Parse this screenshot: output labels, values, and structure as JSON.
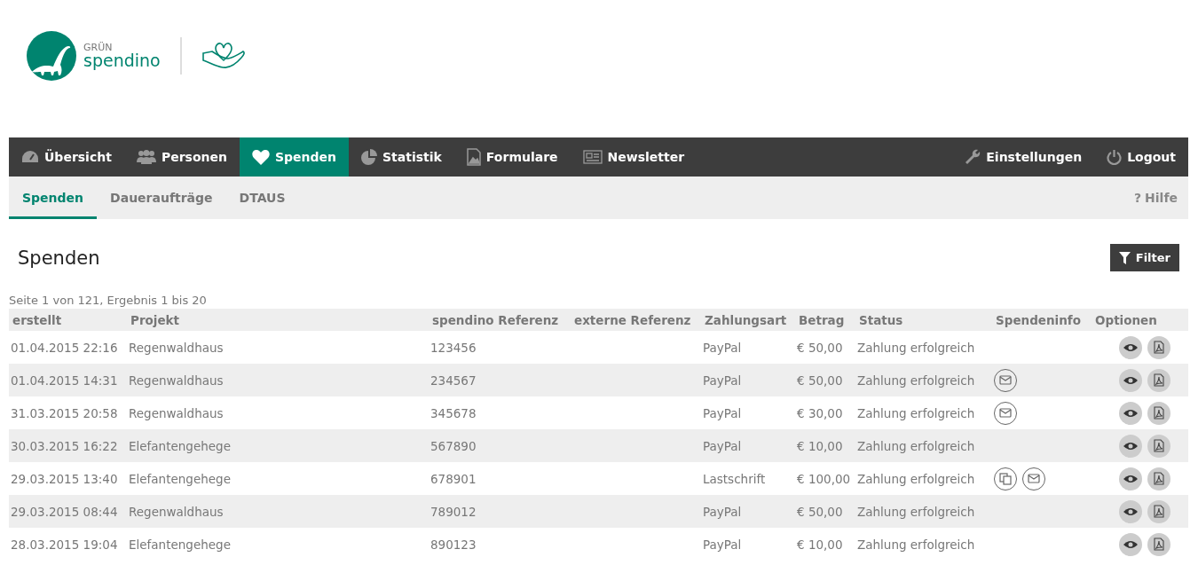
{
  "logo": {
    "line1": "GRÜN",
    "line2": "spendino"
  },
  "nav": [
    {
      "label": "Übersicht",
      "kind": "gauge",
      "selected": false
    },
    {
      "label": "Personen",
      "kind": "people",
      "selected": false
    },
    {
      "label": "Spenden",
      "kind": "heart",
      "selected": true
    },
    {
      "label": "Statistik",
      "kind": "pie",
      "selected": false
    },
    {
      "label": "Formulare",
      "kind": "image",
      "selected": false
    },
    {
      "label": "Newsletter",
      "kind": "news",
      "selected": false
    }
  ],
  "nav_right": [
    {
      "label": "Einstellungen",
      "kind": "wrench"
    },
    {
      "label": "Logout",
      "kind": "power"
    }
  ],
  "subnav": [
    {
      "label": "Spenden",
      "selected": true
    },
    {
      "label": "Daueraufträge",
      "selected": false
    },
    {
      "label": "DTAUS",
      "selected": false
    }
  ],
  "help": {
    "icon_text": "?",
    "label": "Hilfe"
  },
  "page_title": "Spenden",
  "filter_button": "Filter",
  "pagination": "Seite 1 von 121, Ergebnis 1 bis 20",
  "table": {
    "columns": [
      "erstellt",
      "Projekt",
      "spendino Referenz",
      "externe Referenz",
      "Zahlungsart",
      "Betrag",
      "Status",
      "Spendeninfo",
      "Optionen"
    ],
    "rows": [
      {
        "created": "01.04.2015 22:16",
        "project": "Regenwaldhaus",
        "ref": "123456",
        "payment": "PayPal",
        "amount": "€ 50,00",
        "status": "Zahlung erfolgreich",
        "info": []
      },
      {
        "created": "01.04.2015 14:31",
        "project": "Regenwaldhaus",
        "ref": "234567",
        "payment": "PayPal",
        "amount": "€ 50,00",
        "status": "Zahlung erfolgreich",
        "info": [
          {
            "kind": "mail"
          }
        ]
      },
      {
        "created": "31.03.2015 20:58",
        "project": "Regenwaldhaus",
        "ref": "345678",
        "payment": "PayPal",
        "amount": "€ 30,00",
        "status": "Zahlung erfolgreich",
        "info": [
          {
            "kind": "mail"
          }
        ]
      },
      {
        "created": "30.03.2015 16:22",
        "project": "Elefantengehege",
        "ref": "567890",
        "payment": "PayPal",
        "amount": "€ 10,00",
        "status": "Zahlung erfolgreich",
        "info": []
      },
      {
        "created": "29.03.2015 13:40",
        "project": "Elefantengehege",
        "ref": "678901",
        "payment": "Lastschrift",
        "amount": "€ 100,00",
        "status": "Zahlung erfolgreich",
        "info": [
          {
            "kind": "copy"
          },
          {
            "kind": "mail"
          }
        ]
      },
      {
        "created": "29.03.2015 08:44",
        "project": "Regenwaldhaus",
        "ref": "789012",
        "payment": "PayPal",
        "amount": "€ 50,00",
        "status": "Zahlung erfolgreich",
        "info": []
      },
      {
        "created": "28.03.2015 19:04",
        "project": "Elefantengehege",
        "ref": "890123",
        "payment": "PayPal",
        "amount": "€ 10,00",
        "status": "Zahlung erfolgreich",
        "info": []
      }
    ]
  }
}
